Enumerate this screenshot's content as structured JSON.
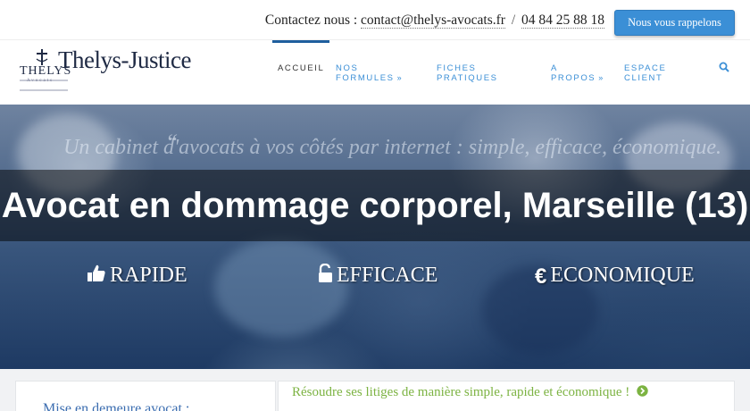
{
  "topbar": {
    "contact_label": "Contactez nous :",
    "email": "contact@thelys-avocats.fr",
    "separator": "/",
    "phone": "04 84 25 88 18",
    "callback_button": "Nous vous rappelons"
  },
  "logo": {
    "name": "Thelys-Justice",
    "mark_text": "THELYS",
    "mark_subtext": "Avocats"
  },
  "nav": {
    "items": [
      {
        "label": "ACCUEIL",
        "active": true
      },
      {
        "label_line1": "NOS",
        "label_line2": "FORMULES",
        "dropdown": true
      },
      {
        "label_line1": "FICHES",
        "label_line2": "PRATIQUES"
      },
      {
        "label_line1": "A",
        "label_line2": "PROPOS",
        "dropdown": true
      },
      {
        "label_line1": "ESPACE",
        "label_line2": "CLIENT"
      }
    ],
    "search_icon": "search-icon"
  },
  "hero": {
    "quote": "Un cabinet d'avocats à vos côtés par internet : simple, efficace, économique.",
    "title": "Avocat en dommage corporel, Marseille (13)",
    "features": [
      {
        "icon": "thumbs-up-icon",
        "label": "RAPIDE"
      },
      {
        "icon": "unlock-icon",
        "label": "EFFICACE"
      },
      {
        "icon": "euro-icon",
        "label": "ECONOMIQUE"
      }
    ]
  },
  "content": {
    "left_heading": "Mise en demeure avocat :",
    "tagline": "Résoudre ses litiges de manière simple, rapide et économique !",
    "tagline_icon": "arrow-right-circle-icon"
  },
  "colors": {
    "accent": "#3b8fd6",
    "brand_navy": "#1f2a44",
    "tagline_green": "#7cb342"
  }
}
